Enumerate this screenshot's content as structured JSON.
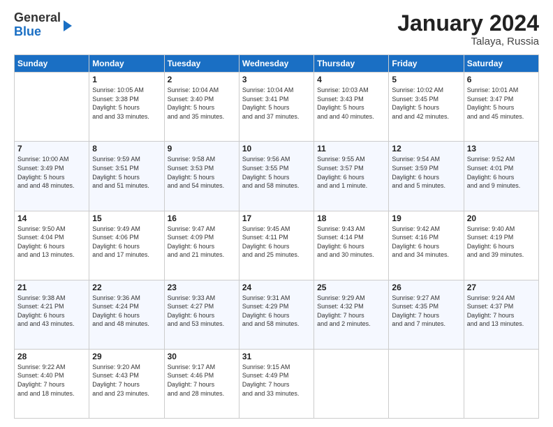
{
  "header": {
    "logo_general": "General",
    "logo_blue": "Blue",
    "month_title": "January 2024",
    "location": "Talaya, Russia"
  },
  "weekdays": [
    "Sunday",
    "Monday",
    "Tuesday",
    "Wednesday",
    "Thursday",
    "Friday",
    "Saturday"
  ],
  "weeks": [
    [
      {
        "day": "",
        "sunrise": "",
        "sunset": "",
        "daylight": ""
      },
      {
        "day": "1",
        "sunrise": "Sunrise: 10:05 AM",
        "sunset": "Sunset: 3:38 PM",
        "daylight": "Daylight: 5 hours and 33 minutes."
      },
      {
        "day": "2",
        "sunrise": "Sunrise: 10:04 AM",
        "sunset": "Sunset: 3:40 PM",
        "daylight": "Daylight: 5 hours and 35 minutes."
      },
      {
        "day": "3",
        "sunrise": "Sunrise: 10:04 AM",
        "sunset": "Sunset: 3:41 PM",
        "daylight": "Daylight: 5 hours and 37 minutes."
      },
      {
        "day": "4",
        "sunrise": "Sunrise: 10:03 AM",
        "sunset": "Sunset: 3:43 PM",
        "daylight": "Daylight: 5 hours and 40 minutes."
      },
      {
        "day": "5",
        "sunrise": "Sunrise: 10:02 AM",
        "sunset": "Sunset: 3:45 PM",
        "daylight": "Daylight: 5 hours and 42 minutes."
      },
      {
        "day": "6",
        "sunrise": "Sunrise: 10:01 AM",
        "sunset": "Sunset: 3:47 PM",
        "daylight": "Daylight: 5 hours and 45 minutes."
      }
    ],
    [
      {
        "day": "7",
        "sunrise": "Sunrise: 10:00 AM",
        "sunset": "Sunset: 3:49 PM",
        "daylight": "Daylight: 5 hours and 48 minutes."
      },
      {
        "day": "8",
        "sunrise": "Sunrise: 9:59 AM",
        "sunset": "Sunset: 3:51 PM",
        "daylight": "Daylight: 5 hours and 51 minutes."
      },
      {
        "day": "9",
        "sunrise": "Sunrise: 9:58 AM",
        "sunset": "Sunset: 3:53 PM",
        "daylight": "Daylight: 5 hours and 54 minutes."
      },
      {
        "day": "10",
        "sunrise": "Sunrise: 9:56 AM",
        "sunset": "Sunset: 3:55 PM",
        "daylight": "Daylight: 5 hours and 58 minutes."
      },
      {
        "day": "11",
        "sunrise": "Sunrise: 9:55 AM",
        "sunset": "Sunset: 3:57 PM",
        "daylight": "Daylight: 6 hours and 1 minute."
      },
      {
        "day": "12",
        "sunrise": "Sunrise: 9:54 AM",
        "sunset": "Sunset: 3:59 PM",
        "daylight": "Daylight: 6 hours and 5 minutes."
      },
      {
        "day": "13",
        "sunrise": "Sunrise: 9:52 AM",
        "sunset": "Sunset: 4:01 PM",
        "daylight": "Daylight: 6 hours and 9 minutes."
      }
    ],
    [
      {
        "day": "14",
        "sunrise": "Sunrise: 9:50 AM",
        "sunset": "Sunset: 4:04 PM",
        "daylight": "Daylight: 6 hours and 13 minutes."
      },
      {
        "day": "15",
        "sunrise": "Sunrise: 9:49 AM",
        "sunset": "Sunset: 4:06 PM",
        "daylight": "Daylight: 6 hours and 17 minutes."
      },
      {
        "day": "16",
        "sunrise": "Sunrise: 9:47 AM",
        "sunset": "Sunset: 4:09 PM",
        "daylight": "Daylight: 6 hours and 21 minutes."
      },
      {
        "day": "17",
        "sunrise": "Sunrise: 9:45 AM",
        "sunset": "Sunset: 4:11 PM",
        "daylight": "Daylight: 6 hours and 25 minutes."
      },
      {
        "day": "18",
        "sunrise": "Sunrise: 9:43 AM",
        "sunset": "Sunset: 4:14 PM",
        "daylight": "Daylight: 6 hours and 30 minutes."
      },
      {
        "day": "19",
        "sunrise": "Sunrise: 9:42 AM",
        "sunset": "Sunset: 4:16 PM",
        "daylight": "Daylight: 6 hours and 34 minutes."
      },
      {
        "day": "20",
        "sunrise": "Sunrise: 9:40 AM",
        "sunset": "Sunset: 4:19 PM",
        "daylight": "Daylight: 6 hours and 39 minutes."
      }
    ],
    [
      {
        "day": "21",
        "sunrise": "Sunrise: 9:38 AM",
        "sunset": "Sunset: 4:21 PM",
        "daylight": "Daylight: 6 hours and 43 minutes."
      },
      {
        "day": "22",
        "sunrise": "Sunrise: 9:36 AM",
        "sunset": "Sunset: 4:24 PM",
        "daylight": "Daylight: 6 hours and 48 minutes."
      },
      {
        "day": "23",
        "sunrise": "Sunrise: 9:33 AM",
        "sunset": "Sunset: 4:27 PM",
        "daylight": "Daylight: 6 hours and 53 minutes."
      },
      {
        "day": "24",
        "sunrise": "Sunrise: 9:31 AM",
        "sunset": "Sunset: 4:29 PM",
        "daylight": "Daylight: 6 hours and 58 minutes."
      },
      {
        "day": "25",
        "sunrise": "Sunrise: 9:29 AM",
        "sunset": "Sunset: 4:32 PM",
        "daylight": "Daylight: 7 hours and 2 minutes."
      },
      {
        "day": "26",
        "sunrise": "Sunrise: 9:27 AM",
        "sunset": "Sunset: 4:35 PM",
        "daylight": "Daylight: 7 hours and 7 minutes."
      },
      {
        "day": "27",
        "sunrise": "Sunrise: 9:24 AM",
        "sunset": "Sunset: 4:37 PM",
        "daylight": "Daylight: 7 hours and 13 minutes."
      }
    ],
    [
      {
        "day": "28",
        "sunrise": "Sunrise: 9:22 AM",
        "sunset": "Sunset: 4:40 PM",
        "daylight": "Daylight: 7 hours and 18 minutes."
      },
      {
        "day": "29",
        "sunrise": "Sunrise: 9:20 AM",
        "sunset": "Sunset: 4:43 PM",
        "daylight": "Daylight: 7 hours and 23 minutes."
      },
      {
        "day": "30",
        "sunrise": "Sunrise: 9:17 AM",
        "sunset": "Sunset: 4:46 PM",
        "daylight": "Daylight: 7 hours and 28 minutes."
      },
      {
        "day": "31",
        "sunrise": "Sunrise: 9:15 AM",
        "sunset": "Sunset: 4:49 PM",
        "daylight": "Daylight: 7 hours and 33 minutes."
      },
      {
        "day": "",
        "sunrise": "",
        "sunset": "",
        "daylight": ""
      },
      {
        "day": "",
        "sunrise": "",
        "sunset": "",
        "daylight": ""
      },
      {
        "day": "",
        "sunrise": "",
        "sunset": "",
        "daylight": ""
      }
    ]
  ]
}
